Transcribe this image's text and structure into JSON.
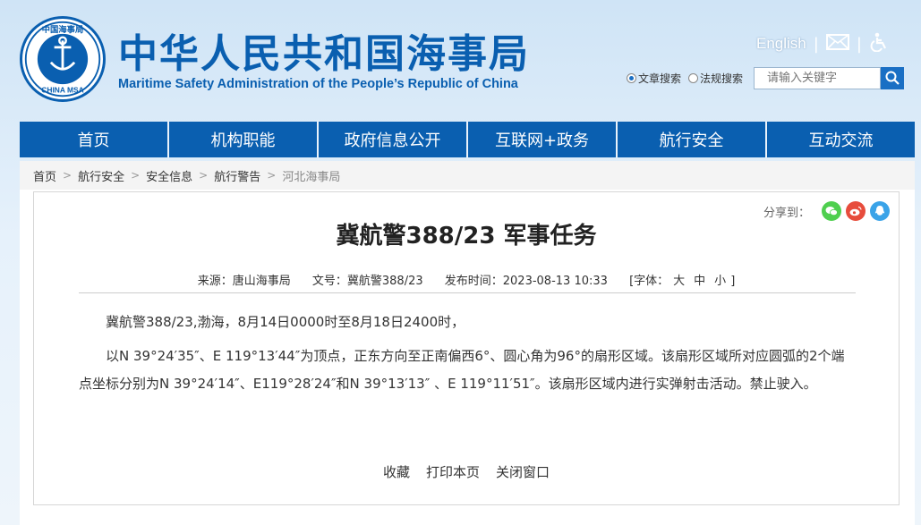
{
  "header": {
    "logo_text_top": "中国海事局",
    "logo_text_bottom": "CHINA MSA",
    "title_cn": "中华人民共和国海事局",
    "title_en": "Maritime Safety Administration of the People’s Republic of China",
    "english_link": "English",
    "search": {
      "option_article": "文章搜索",
      "option_regulation": "法规搜索",
      "placeholder": "请输入关键字"
    }
  },
  "nav": {
    "items": [
      "首页",
      "机构职能",
      "政府信息公开",
      "互联网+政务",
      "航行安全",
      "互动交流"
    ]
  },
  "breadcrumb": {
    "items": [
      "首页",
      "航行安全",
      "安全信息",
      "航行警告",
      "河北海事局"
    ]
  },
  "article": {
    "share_label": "分享到：",
    "title": "冀航警388/23 军事任务",
    "source": "来源：唐山海事局",
    "doc_no": "文号：冀航警388/23",
    "publish_time": "发布时间：2023-08-13 10:33",
    "font_label": "[字体：",
    "font_large": "大",
    "font_medium": "中",
    "font_small": "小",
    "font_close": "]",
    "paragraphs": [
      "冀航警388/23,渤海，8月14日0000时至8月18日2400时，",
      "以N 39°24′35″、E 119°13′44″为顶点，正东方向至正南偏西6°、圆心角为96°的扇形区域。该扇形区域所对应圆弧的2个端点坐标分别为N 39°24′14″、E119°28′24″和N 39°13′13″ 、E 119°11′51″。该扇形区域内进行实弹射击活动。禁止驶入。"
    ],
    "actions": {
      "favorite": "收藏",
      "print": "打印本页",
      "close": "关闭窗口"
    }
  },
  "colors": {
    "brand_blue": "#0a5fb0",
    "nav_blue": "#0a5fb0",
    "wechat_green": "#4fcf4f",
    "weibo_red": "#e74c3c",
    "qq_blue": "#3aa3e8"
  }
}
